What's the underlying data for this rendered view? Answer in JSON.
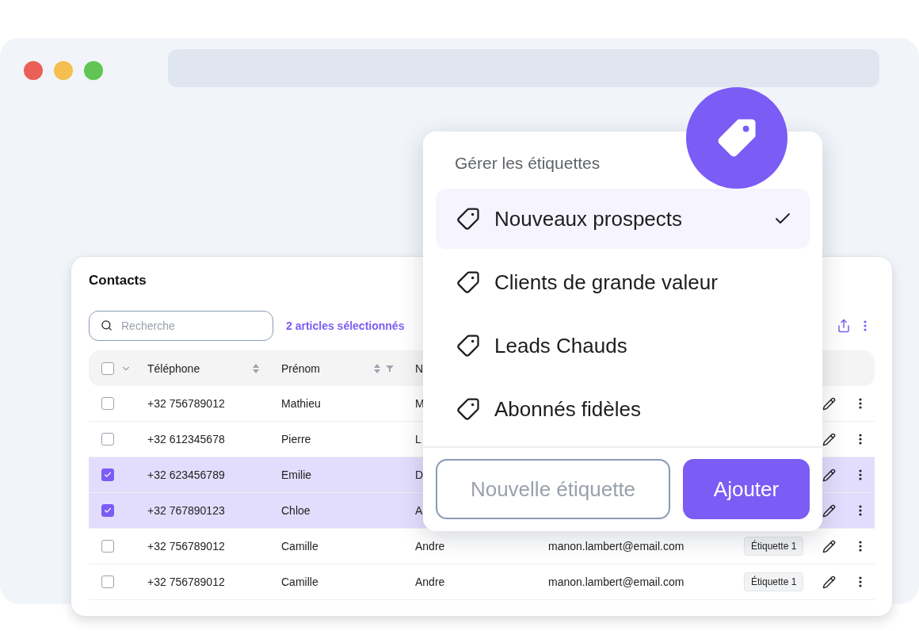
{
  "contacts": {
    "title": "Contacts",
    "search": {
      "placeholder": "Recherche"
    },
    "selection_info": "2 articles sélectionnés",
    "header_checkbox": {
      "checked": false
    },
    "columns": [
      {
        "label": "Téléphone",
        "sortable": true,
        "filter": false
      },
      {
        "label": "Prénom",
        "sortable": true,
        "filter": true
      },
      {
        "label": "N"
      }
    ],
    "rows": [
      {
        "phone": "+32 756789012",
        "first_name": "Mathieu",
        "column_3": "M",
        "selected": false
      },
      {
        "phone": "+32 612345678",
        "first_name": "Pierre",
        "column_3": "L",
        "selected": false
      },
      {
        "phone": "+32 623456789",
        "first_name": "Emilie",
        "column_3": "D",
        "selected": true
      },
      {
        "phone": "+32 767890123",
        "first_name": "Chloe",
        "column_3": "A",
        "selected": true
      },
      {
        "phone": "+32 756789012",
        "first_name": "Camille",
        "column_3": "Andre",
        "email": "manon.lambert@email.com",
        "tag": "Étiquette 1",
        "selected": false
      },
      {
        "phone": "+32 756789012",
        "first_name": "Camille",
        "column_3": "Andre",
        "email": "manon.lambert@email.com",
        "tag": "Étiquette 1",
        "selected": false
      }
    ]
  },
  "tag_menu": {
    "title": "Gérer les étiquettes",
    "items": [
      {
        "label": "Nouveaux prospects",
        "selected": true
      },
      {
        "label": "Clients de grande valeur",
        "selected": false
      },
      {
        "label": "Leads Chauds",
        "selected": false
      },
      {
        "label": "Abonnés fidèles",
        "selected": false
      }
    ],
    "new_tag": {
      "placeholder": "Nouvelle étiquette"
    },
    "add_button": "Ajouter"
  }
}
